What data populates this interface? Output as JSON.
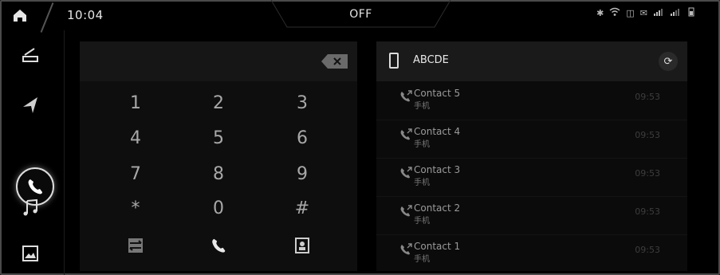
{
  "status": {
    "time": "10:04",
    "center_label": "OFF",
    "icons": [
      "bluetooth-icon",
      "wifi-icon",
      "sim-icon",
      "mail-icon",
      "signal-icon",
      "signal-icon",
      "battery-icon"
    ]
  },
  "rail": [
    "car-icon",
    "navigation-icon",
    "phone-icon",
    "music-icon",
    "gallery-icon"
  ],
  "dialer": {
    "input_value": "",
    "keys": [
      "1",
      "2",
      "3",
      "4",
      "5",
      "6",
      "7",
      "8",
      "9",
      "*",
      "0",
      "#"
    ],
    "actions": [
      "contacts-switch-icon",
      "call-icon",
      "contact-book-icon"
    ]
  },
  "recents": {
    "device_name": "ABCDE",
    "calls": [
      {
        "name": "Contact 5",
        "type": "手机",
        "time": "09:53"
      },
      {
        "name": "Contact 4",
        "type": "手机",
        "time": "09:53"
      },
      {
        "name": "Contact 3",
        "type": "手机",
        "time": "09:53"
      },
      {
        "name": "Contact 2",
        "type": "手机",
        "time": "09:53"
      },
      {
        "name": "Contact 1",
        "type": "手机",
        "time": "09:53"
      }
    ]
  },
  "colors": {
    "background": "#000000",
    "panel": "#0e0e0e",
    "accent": "#dddddd"
  }
}
